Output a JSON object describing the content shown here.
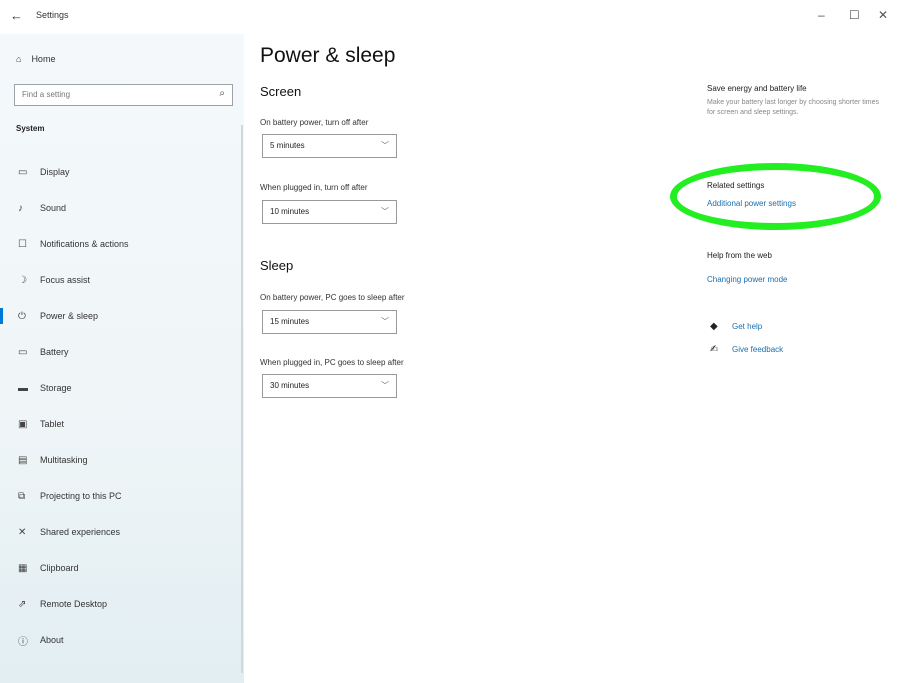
{
  "titlebar": {
    "back_icon": "back-arrow-icon",
    "title": "Settings",
    "controls": [
      "–",
      "☐",
      "✕"
    ]
  },
  "sidebar": {
    "home_label": "Home",
    "search_placeholder": "Find a setting",
    "section_label": "System",
    "items": [
      {
        "label": "Display",
        "icon": "display-icon"
      },
      {
        "label": "Sound",
        "icon": "sound-icon"
      },
      {
        "label": "Notifications & actions",
        "icon": "notifications-icon"
      },
      {
        "label": "Focus assist",
        "icon": "focus-assist-icon"
      },
      {
        "label": "Power & sleep",
        "icon": "power-icon",
        "active": true
      },
      {
        "label": "Battery",
        "icon": "battery-icon"
      },
      {
        "label": "Storage",
        "icon": "storage-icon"
      },
      {
        "label": "Tablet",
        "icon": "tablet-icon"
      },
      {
        "label": "Multitasking",
        "icon": "multitasking-icon"
      },
      {
        "label": "Projecting to this PC",
        "icon": "projecting-icon"
      },
      {
        "label": "Shared experiences",
        "icon": "shared-experiences-icon"
      },
      {
        "label": "Clipboard",
        "icon": "clipboard-icon"
      },
      {
        "label": "Remote Desktop",
        "icon": "remote-desktop-icon"
      },
      {
        "label": "About",
        "icon": "about-icon"
      }
    ]
  },
  "main": {
    "title": "Power & sleep",
    "screen": {
      "heading": "Screen",
      "battery_label": "On battery power, turn off after",
      "battery_value": "5 minutes",
      "plugged_label": "When plugged in, turn off after",
      "plugged_value": "10 minutes"
    },
    "sleep": {
      "heading": "Sleep",
      "battery_label": "On battery power, PC goes to sleep after",
      "battery_value": "15 minutes",
      "plugged_label": "When plugged in, PC goes to sleep after",
      "plugged_value": "30 minutes"
    }
  },
  "right": {
    "save_title": "Save energy and battery life",
    "save_text": "Make your battery last longer by choosing shorter times for screen and sleep settings.",
    "related_title": "Related settings",
    "related_link": "Additional power settings",
    "help_title": "Help from the web",
    "help_link": "Changing power mode",
    "get_help": "Get help",
    "give_feedback": "Give feedback"
  },
  "colors": {
    "accent": "#0078d7",
    "link": "#1a6fb0",
    "highlight": "#22ee22"
  }
}
